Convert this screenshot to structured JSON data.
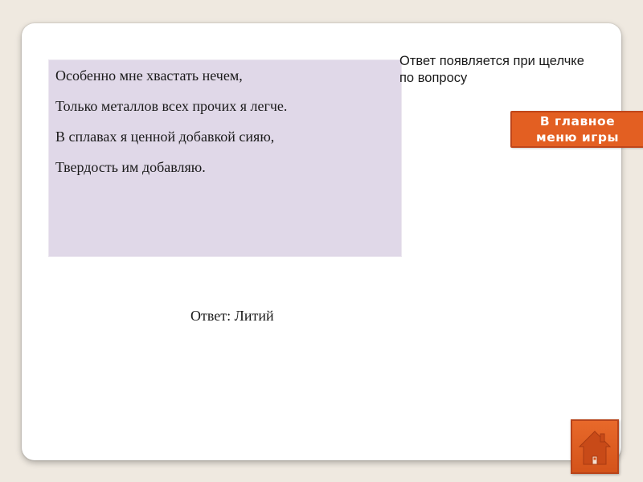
{
  "question": {
    "lines": [
      "Особенно мне хвастать нечем,",
      "Только металлов всех прочих я легче.",
      "В сплавах я ценной добавкой сияю,",
      "Твердость им добавляю."
    ]
  },
  "hint": {
    "text": "Ответ появляется при щелчке по вопросу"
  },
  "menu_button": {
    "line1": "В главное",
    "line2": "меню игры"
  },
  "answer": {
    "text": "Ответ: Литий"
  },
  "home_button": {
    "icon": "home-icon"
  },
  "colors": {
    "background": "#efe9e0",
    "slide": "#ffffff",
    "question_box": "#e0d8e8",
    "accent": "#e35f22"
  }
}
